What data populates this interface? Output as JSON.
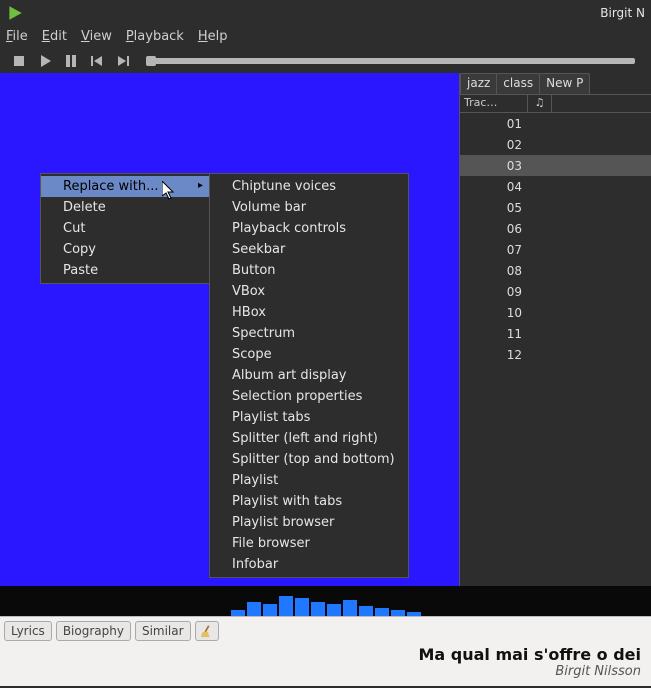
{
  "titlebar": {
    "user": "Birgit N"
  },
  "menubar": {
    "file": "File",
    "edit": "Edit",
    "view": "View",
    "playback": "Playback",
    "help": "Help"
  },
  "context_menu": {
    "items": [
      {
        "label": "Replace with...",
        "hover": true,
        "submenu": true
      },
      {
        "label": "Delete"
      },
      {
        "label": "Cut"
      },
      {
        "label": "Copy"
      },
      {
        "label": "Paste"
      }
    ]
  },
  "submenu": {
    "items": [
      "Chiptune voices",
      "Volume bar",
      "Playback controls",
      "Seekbar",
      "Button",
      "VBox",
      "HBox",
      "Spectrum",
      "Scope",
      "Album art display",
      "Selection properties",
      "Playlist tabs",
      "Splitter (left and right)",
      "Splitter (top and bottom)",
      "Playlist",
      "Playlist with tabs",
      "Playlist browser",
      "File browser",
      "Infobar"
    ]
  },
  "playlist": {
    "tabs": [
      "jazz",
      "class",
      "New P"
    ],
    "columns": {
      "trackno": "Trac…",
      "icon": "♫"
    },
    "rows": [
      "01",
      "02",
      "03",
      "04",
      "05",
      "06",
      "07",
      "08",
      "09",
      "10",
      "11",
      "12"
    ],
    "selected_index": 2
  },
  "info": {
    "tabs": [
      "Lyrics",
      "Biography",
      "Similar"
    ],
    "now_playing_title": "Ma qual mai s'offre o dei",
    "now_playing_artist": "Birgit Nilsson"
  },
  "spectrum_bars": [
    6,
    14,
    12,
    20,
    18,
    14,
    12,
    16,
    10,
    8,
    6,
    4
  ]
}
